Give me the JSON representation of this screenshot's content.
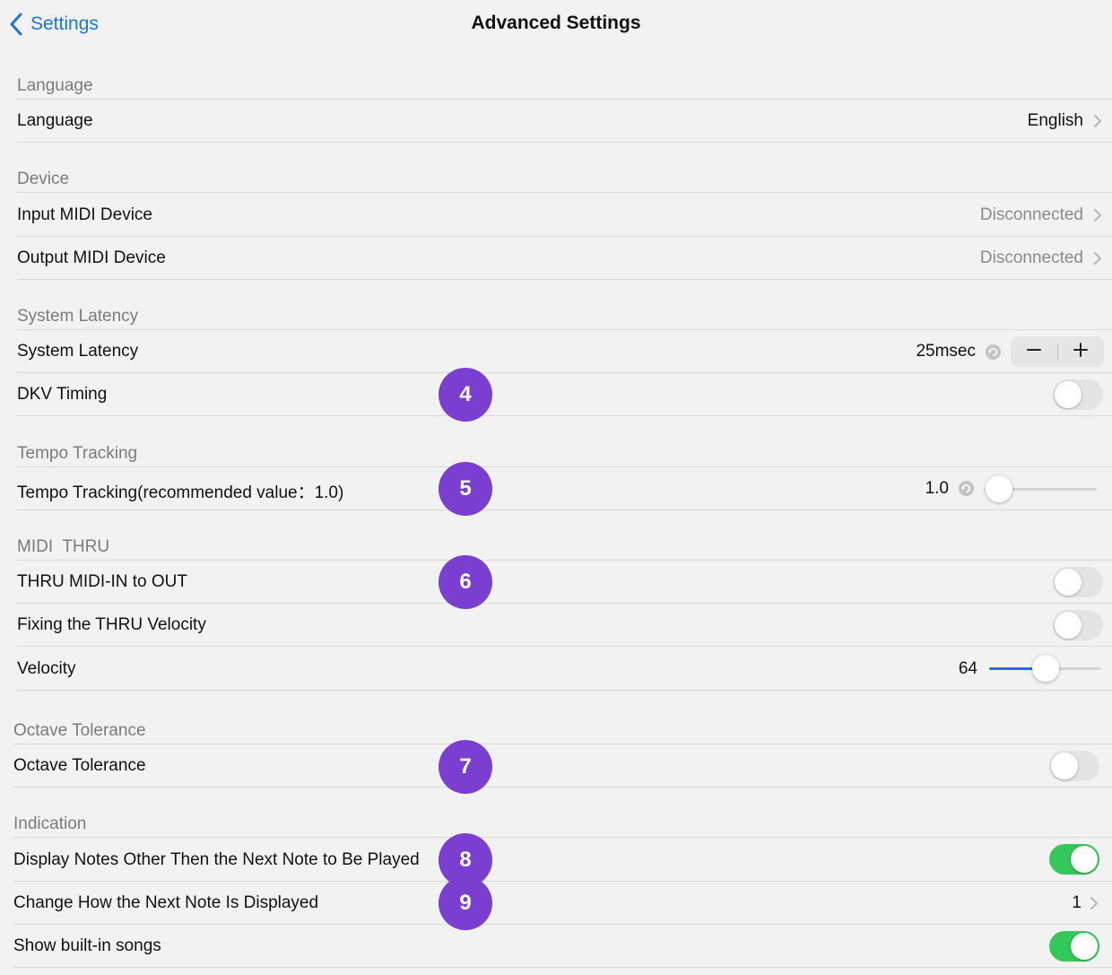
{
  "nav": {
    "back_label": "Settings",
    "title": "Advanced Settings"
  },
  "sections": {
    "language": {
      "header": "Language",
      "rows": [
        {
          "label": "Language",
          "value": "English"
        }
      ]
    },
    "device": {
      "header": "Device",
      "rows": [
        {
          "label": "Input MIDI Device",
          "value": "Disconnected"
        },
        {
          "label": "Output MIDI Device",
          "value": "Disconnected"
        }
      ]
    },
    "system_latency": {
      "header": "System Latency",
      "rows": [
        {
          "label": "System Latency",
          "value": "25msec",
          "stepper_minus": "−",
          "stepper_plus": "+"
        },
        {
          "label": "DKV Timing",
          "toggle_on": false
        }
      ]
    },
    "tempo_tracking": {
      "header": "Tempo Tracking",
      "rows": [
        {
          "label": "Tempo Tracking(recommended value：1.0)",
          "value": "1.0",
          "slider_fraction": 0.0
        }
      ]
    },
    "midi_thru": {
      "header": "MIDI  THRU",
      "rows": [
        {
          "label": "THRU MIDI-IN to OUT",
          "toggle_on": false
        },
        {
          "label": "Fixing the THRU Velocity",
          "toggle_on": false
        },
        {
          "label": "Velocity",
          "value": "64",
          "slider_fraction": 0.5
        }
      ]
    },
    "octave_tolerance": {
      "header": "Octave Tolerance",
      "rows": [
        {
          "label": "Octave Tolerance",
          "toggle_on": false
        }
      ]
    },
    "indication": {
      "header": "Indication",
      "rows": [
        {
          "label": "Display Notes Other Then the Next Note to Be Played",
          "toggle_on": true
        },
        {
          "label": "Change How the Next Note Is Displayed",
          "value": "1"
        },
        {
          "label": "Show built-in songs",
          "toggle_on": true
        }
      ]
    }
  },
  "badges": [
    "4",
    "5",
    "6",
    "7",
    "8",
    "9"
  ],
  "colors": {
    "accent_blue": "#1a73e8",
    "toggle_on_green": "#34c759",
    "badge_purple": "#7a3fd0",
    "background": "#f2f2f2"
  },
  "icons": {
    "back": "chevron-left-icon",
    "disclosure": "chevron-right-icon",
    "reset": "reset-icon"
  }
}
